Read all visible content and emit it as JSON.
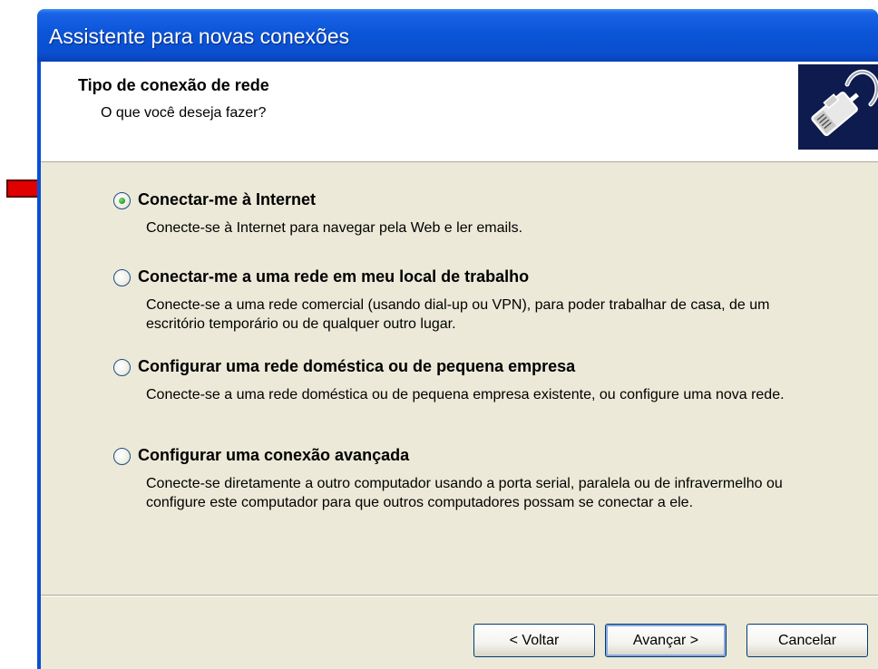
{
  "window": {
    "title": "Assistente para novas conexões"
  },
  "header": {
    "title": "Tipo de conexão de rede",
    "subtitle": "O que você deseja fazer?"
  },
  "options": [
    {
      "label": "Conectar-me à Internet",
      "description": "Conecte-se à Internet para navegar pela Web e ler emails.",
      "selected": true
    },
    {
      "label": "Conectar-me a uma rede em meu local de trabalho",
      "description": "Conecte-se a uma rede comercial (usando dial-up ou VPN), para poder trabalhar de casa, de um escritório temporário ou de qualquer outro lugar.",
      "selected": false
    },
    {
      "label": "Configurar uma rede doméstica ou de pequena empresa",
      "description": "Conecte-se a uma rede doméstica ou de pequena empresa existente, ou configure uma nova rede.",
      "selected": false
    },
    {
      "label": "Configurar uma conexão avançada",
      "description": "Conecte-se diretamente a outro computador usando a porta serial, paralela ou de infravermelho ou configure este computador para que outros computadores possam se conectar a ele.",
      "selected": false
    }
  ],
  "buttons": {
    "back": "< Voltar",
    "next": "Avançar >",
    "cancel": "Cancelar"
  },
  "colors": {
    "titlebar": "#0a4ed6",
    "client_bg": "#ece9d8",
    "annotation_arrow": "#e00000"
  },
  "icons": {
    "header_icon": "network-cable-icon",
    "annotation": "red-arrow-icon"
  }
}
